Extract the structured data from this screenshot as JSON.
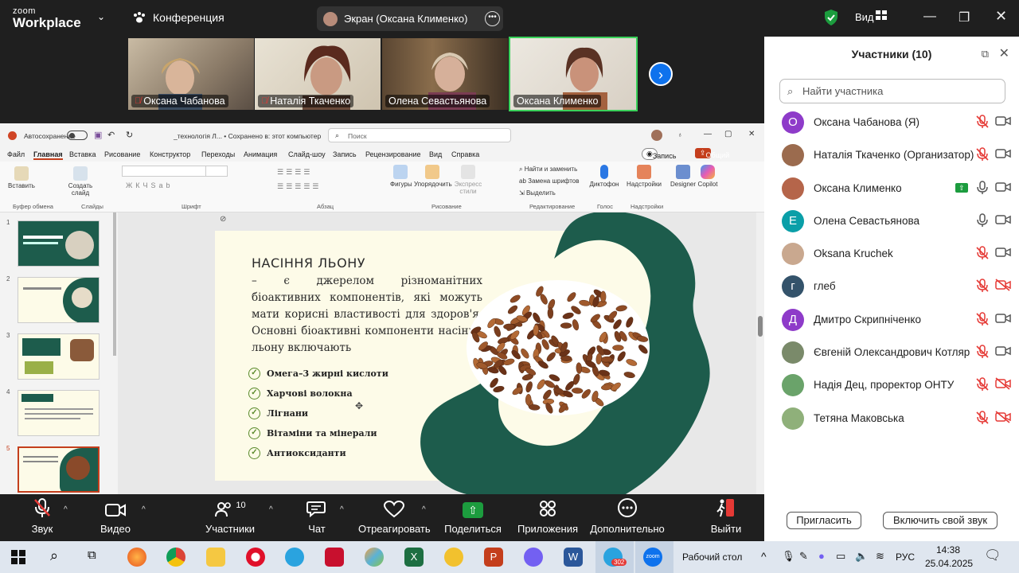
{
  "app": {
    "logo_line1": "zoom",
    "logo_line2": "Workplace",
    "conference_label": "Конференция",
    "screen_share_label": "Экран (Оксана Клименко)",
    "view_label": "Вид"
  },
  "video_tiles": [
    {
      "name": "Оксана Чабанова",
      "muted": true
    },
    {
      "name": "Наталія Ткаченко",
      "muted": true
    },
    {
      "name": "Олена Севастьянова",
      "muted": false
    },
    {
      "name": "Оксана Клименко",
      "muted": false
    }
  ],
  "powerpoint": {
    "autosave_label": "Автосохранение",
    "doc_title": "_технологія Л... • Сохранено в: этот компьютер",
    "search_placeholder": "Поиск",
    "menu": [
      "Файл",
      "Главная",
      "Вставка",
      "Рисование",
      "Конструктор",
      "Переходы",
      "Анимация",
      "Слайд-шоу",
      "Запись",
      "Рецензирование",
      "Вид",
      "Справка"
    ],
    "record_label": "Запись",
    "share_label": "Общий доступ",
    "ribbon": {
      "paste": "Вставить",
      "new_slide": "Создать слайд",
      "shapes": "Фигуры",
      "arrange": "Упорядочить",
      "express_styles": "Экспресс стили",
      "find_replace": "Найти и заменить",
      "replace_fonts": "Замена шрифтов",
      "select": "Выделить",
      "dictate": "Диктофон",
      "addins": "Надстройки",
      "designer": "Designer",
      "copilot": "Copilot",
      "group_clipboard": "Буфер обмена",
      "group_slides": "Слайды",
      "group_font": "Шрифт",
      "group_paragraph": "Абзац",
      "group_drawing": "Рисование",
      "group_editing": "Редактирование",
      "group_voice": "Голос",
      "group_addins": "Надстройки"
    },
    "thumbnails": [
      "1",
      "2",
      "3",
      "4",
      "5"
    ],
    "slide": {
      "title": "НАСІННЯ ЛЬОНУ",
      "body": "– є джерелом різноманітних біоактивних компонентів, які можуть мати корисні властивості для здоров'я. Основні біоактивні компоненти насіння льону включають",
      "bullets": [
        "Омега–3 жирні кислоти",
        "Харчові волокна",
        "Лігнани",
        "Вітаміни та мінерали",
        "Антиоксиданти"
      ]
    }
  },
  "participants_panel": {
    "title": "Участники (10)",
    "search_placeholder": "Найти участника",
    "participants": [
      {
        "name": "Оксана Чабанова (Я)",
        "avatar_letter": "О",
        "avatar_color": "#8e3bc9",
        "mic": "muted",
        "cam": "on"
      },
      {
        "name": "Наталія Ткаченко (Организатор)",
        "avatar_letter": "",
        "avatar_color": "#9b6b4e",
        "mic": "muted",
        "cam": "on"
      },
      {
        "name": "Оксана Клименко",
        "avatar_letter": "",
        "avatar_color": "#b5654a",
        "mic": "on",
        "cam": "on",
        "sharing": true
      },
      {
        "name": "Олена Севастьянова",
        "avatar_letter": "Е",
        "avatar_color": "#0a9fa8",
        "mic": "on",
        "cam": "on"
      },
      {
        "name": "Oksana Kruchek",
        "avatar_letter": "",
        "avatar_color": "#c9a88f",
        "mic": "muted",
        "cam": "on"
      },
      {
        "name": "глеб",
        "avatar_letter": "г",
        "avatar_color": "#34536b",
        "mic": "muted",
        "cam": "off"
      },
      {
        "name": "Дмитро Скрипніченко",
        "avatar_letter": "Д",
        "avatar_color": "#8e3bc9",
        "mic": "muted",
        "cam": "on"
      },
      {
        "name": "Євгеній Олександрович Котляр",
        "avatar_letter": "",
        "avatar_color": "#7a8a6a",
        "mic": "muted",
        "cam": "on"
      },
      {
        "name": "Надія Дец, проректор ОНТУ",
        "avatar_letter": "",
        "avatar_color": "#6aa36a",
        "mic": "muted",
        "cam": "off"
      },
      {
        "name": "Тетяна Маковська",
        "avatar_letter": "",
        "avatar_color": "#8fb07a",
        "mic": "muted",
        "cam": "off"
      }
    ],
    "invite_label": "Пригласить",
    "unmute_label": "Включить свой звук"
  },
  "controls": {
    "audio": "Звук",
    "video": "Видео",
    "participants": "Участники",
    "participants_count": "10",
    "chat": "Чат",
    "react": "Отреагировать",
    "share": "Поделиться",
    "apps": "Приложения",
    "more": "Дополнительно",
    "leave": "Выйти"
  },
  "taskbar": {
    "telegram_badge": "302",
    "desktop_label": "Рабочий стол",
    "lang": "РУС",
    "time": "14:38",
    "date": "25.04.2025"
  },
  "colors": {
    "zoom_blue": "#0e72ed",
    "slide_green": "#1d5c4c",
    "muted_red": "#e53935",
    "share_green": "#1c9c3e"
  }
}
